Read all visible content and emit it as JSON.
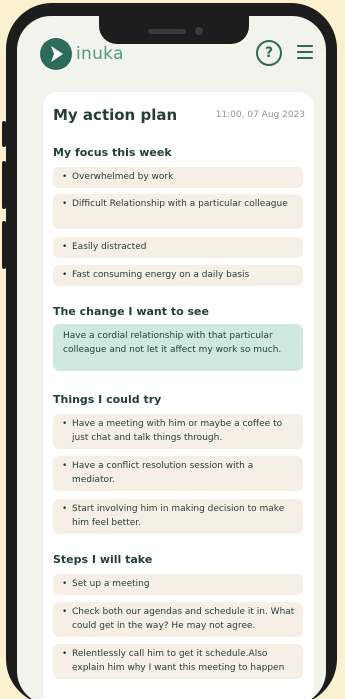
{
  "app": {
    "brand": "inuka",
    "help_label": "?"
  },
  "plan": {
    "title": "My action plan",
    "date": "11:00, 07 Aug 2023",
    "focus": {
      "title": "My focus this week",
      "items": [
        "Overwhelmed by work",
        "Difficult Relationship with a particular colleague",
        "Easily distracted",
        "Fast consuming energy on a daily basis"
      ]
    },
    "change": {
      "title": "The change I want to see",
      "text": "Have a cordial relationship with that particular colleague and not let it affect my work so much."
    },
    "try": {
      "title": "Things I could try",
      "items": [
        "Have a meeting with him or maybe a coffee to just chat and talk things through.",
        "Have a conflict resolution session with a mediator.",
        "Start involving him in making decision to make him feel better."
      ]
    },
    "steps": {
      "title": "Steps I will take",
      "items": [
        "Set up a meeting",
        "Check both our agendas and schedule it in. What could get in the way? He may not agree.",
        "Relentlessly call him to get it schedule.Also explain him why I want this meeting to happen"
      ]
    }
  }
}
